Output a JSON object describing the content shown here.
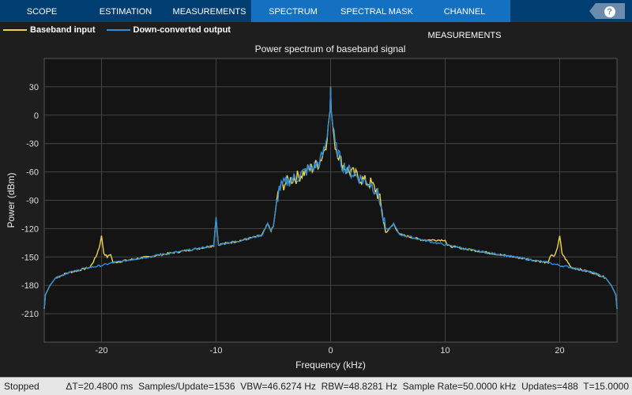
{
  "tabs": [
    {
      "label": "SCOPE",
      "active": false
    },
    {
      "label": "ESTIMATION",
      "active": false
    },
    {
      "label": "MEASUREMENTS",
      "active": false
    },
    {
      "label": "SPECTRUM",
      "active": true
    },
    {
      "label": "SPECTRAL MASK",
      "active": true
    },
    {
      "label": "CHANNEL MEASUREMENTS",
      "active": true
    }
  ],
  "help_label": "?",
  "status": {
    "state": "Stopped",
    "delta_t": "ΔT=20.4800 ms",
    "samples": "Samples/Update=1536",
    "vbw": "VBW=46.6274 Hz",
    "rbw": "RBW=48.8281 Hz",
    "sample_rate": "Sample Rate=50.0000 kHz",
    "updates": "Updates=488",
    "t": "T=15.0000"
  },
  "chart_data": {
    "type": "line",
    "title": "Power spectrum of baseband signal",
    "xlabel": "Frequency (kHz)",
    "ylabel": "Power (dBm)",
    "xlim": [
      -25,
      25
    ],
    "ylim": [
      -240,
      60
    ],
    "xticks": [
      -20,
      -10,
      0,
      10,
      20
    ],
    "yticks": [
      30,
      0,
      -30,
      -60,
      -90,
      -120,
      -150,
      -180,
      -210
    ],
    "grid": true,
    "legend_position": "top-left",
    "series": [
      {
        "name": "Baseband input",
        "color": "#edd34a",
        "points": [
          [
            -25,
            -205
          ],
          [
            -24.9,
            -190
          ],
          [
            -24.5,
            -180
          ],
          [
            -24,
            -172
          ],
          [
            -23,
            -167
          ],
          [
            -22,
            -164
          ],
          [
            -21,
            -161
          ],
          [
            -20.5,
            -150
          ],
          [
            -20.2,
            -140
          ],
          [
            -20,
            -128
          ],
          [
            -19.8,
            -146
          ],
          [
            -19.5,
            -150
          ],
          [
            -19.2,
            -147
          ],
          [
            -19,
            -156
          ],
          [
            -18,
            -154
          ],
          [
            -16,
            -150
          ],
          [
            -14,
            -146
          ],
          [
            -12,
            -142
          ],
          [
            -10.2,
            -138
          ],
          [
            -10,
            -108
          ],
          [
            -9.8,
            -137
          ],
          [
            -8,
            -133
          ],
          [
            -6,
            -127
          ],
          [
            -5.5,
            -115
          ],
          [
            -5.2,
            -122
          ],
          [
            -5,
            -118
          ],
          [
            -4.8,
            -100
          ],
          [
            -4.5,
            -78
          ],
          [
            -4,
            -72
          ],
          [
            -3.5,
            -68
          ],
          [
            -3,
            -66
          ],
          [
            -2.5,
            -62
          ],
          [
            -2,
            -58
          ],
          [
            -1.5,
            -55
          ],
          [
            -1,
            -50
          ],
          [
            -0.7,
            -42
          ],
          [
            -0.4,
            -30
          ],
          [
            -0.2,
            -10
          ],
          [
            -0.05,
            5
          ],
          [
            0,
            30
          ],
          [
            0.05,
            5
          ],
          [
            0.2,
            -12
          ],
          [
            0.4,
            -32
          ],
          [
            0.7,
            -42
          ],
          [
            1,
            -52
          ],
          [
            1.5,
            -58
          ],
          [
            2,
            -62
          ],
          [
            2.5,
            -66
          ],
          [
            3,
            -70
          ],
          [
            3.5,
            -72
          ],
          [
            4,
            -80
          ],
          [
            4.3,
            -90
          ],
          [
            4.6,
            -110
          ],
          [
            4.8,
            -124
          ],
          [
            5,
            -122
          ],
          [
            5.5,
            -115
          ],
          [
            6,
            -126
          ],
          [
            8,
            -132
          ],
          [
            10,
            -132
          ],
          [
            10.2,
            -138
          ],
          [
            12,
            -142
          ],
          [
            14,
            -146
          ],
          [
            16,
            -150
          ],
          [
            18,
            -154
          ],
          [
            19,
            -156
          ],
          [
            19.2,
            -148
          ],
          [
            19.5,
            -150
          ],
          [
            19.8,
            -140
          ],
          [
            20,
            -128
          ],
          [
            20.2,
            -146
          ],
          [
            20.5,
            -152
          ],
          [
            21,
            -161
          ],
          [
            22,
            -164
          ],
          [
            23,
            -167
          ],
          [
            24,
            -172
          ],
          [
            24.5,
            -180
          ],
          [
            24.9,
            -190
          ],
          [
            25,
            -205
          ]
        ]
      },
      {
        "name": "Down-converted output",
        "color": "#2f8fd8",
        "points": [
          [
            -25,
            -205
          ],
          [
            -24.9,
            -190
          ],
          [
            -24.5,
            -180
          ],
          [
            -24,
            -172
          ],
          [
            -23,
            -167
          ],
          [
            -22,
            -164
          ],
          [
            -21,
            -161
          ],
          [
            -20,
            -159
          ],
          [
            -19,
            -156
          ],
          [
            -18,
            -154
          ],
          [
            -16,
            -150
          ],
          [
            -14,
            -146
          ],
          [
            -12,
            -142
          ],
          [
            -10.2,
            -138
          ],
          [
            -10,
            -108
          ],
          [
            -9.8,
            -137
          ],
          [
            -8,
            -133
          ],
          [
            -6,
            -127
          ],
          [
            -5.5,
            -115
          ],
          [
            -5.2,
            -122
          ],
          [
            -5,
            -118
          ],
          [
            -4.8,
            -100
          ],
          [
            -4.5,
            -78
          ],
          [
            -4,
            -72
          ],
          [
            -3.5,
            -68
          ],
          [
            -3,
            -66
          ],
          [
            -2.5,
            -62
          ],
          [
            -2,
            -58
          ],
          [
            -1.5,
            -55
          ],
          [
            -1,
            -50
          ],
          [
            -0.7,
            -42
          ],
          [
            -0.4,
            -30
          ],
          [
            -0.2,
            -10
          ],
          [
            -0.05,
            5
          ],
          [
            0,
            30
          ],
          [
            0.05,
            5
          ],
          [
            0.2,
            -12
          ],
          [
            0.4,
            -32
          ],
          [
            0.7,
            -42
          ],
          [
            1,
            -52
          ],
          [
            1.5,
            -58
          ],
          [
            2,
            -62
          ],
          [
            2.5,
            -66
          ],
          [
            3,
            -70
          ],
          [
            3.5,
            -72
          ],
          [
            4,
            -80
          ],
          [
            4.3,
            -90
          ],
          [
            4.6,
            -110
          ],
          [
            4.8,
            -120
          ],
          [
            5,
            -122
          ],
          [
            5.5,
            -115
          ],
          [
            6,
            -126
          ],
          [
            8,
            -132
          ],
          [
            10,
            -137
          ],
          [
            12,
            -142
          ],
          [
            14,
            -146
          ],
          [
            16,
            -150
          ],
          [
            18,
            -154
          ],
          [
            19,
            -156
          ],
          [
            20,
            -159
          ],
          [
            21,
            -161
          ],
          [
            22,
            -164
          ],
          [
            23,
            -167
          ],
          [
            24,
            -172
          ],
          [
            24.5,
            -180
          ],
          [
            24.9,
            -190
          ],
          [
            25,
            -205
          ]
        ]
      }
    ]
  }
}
